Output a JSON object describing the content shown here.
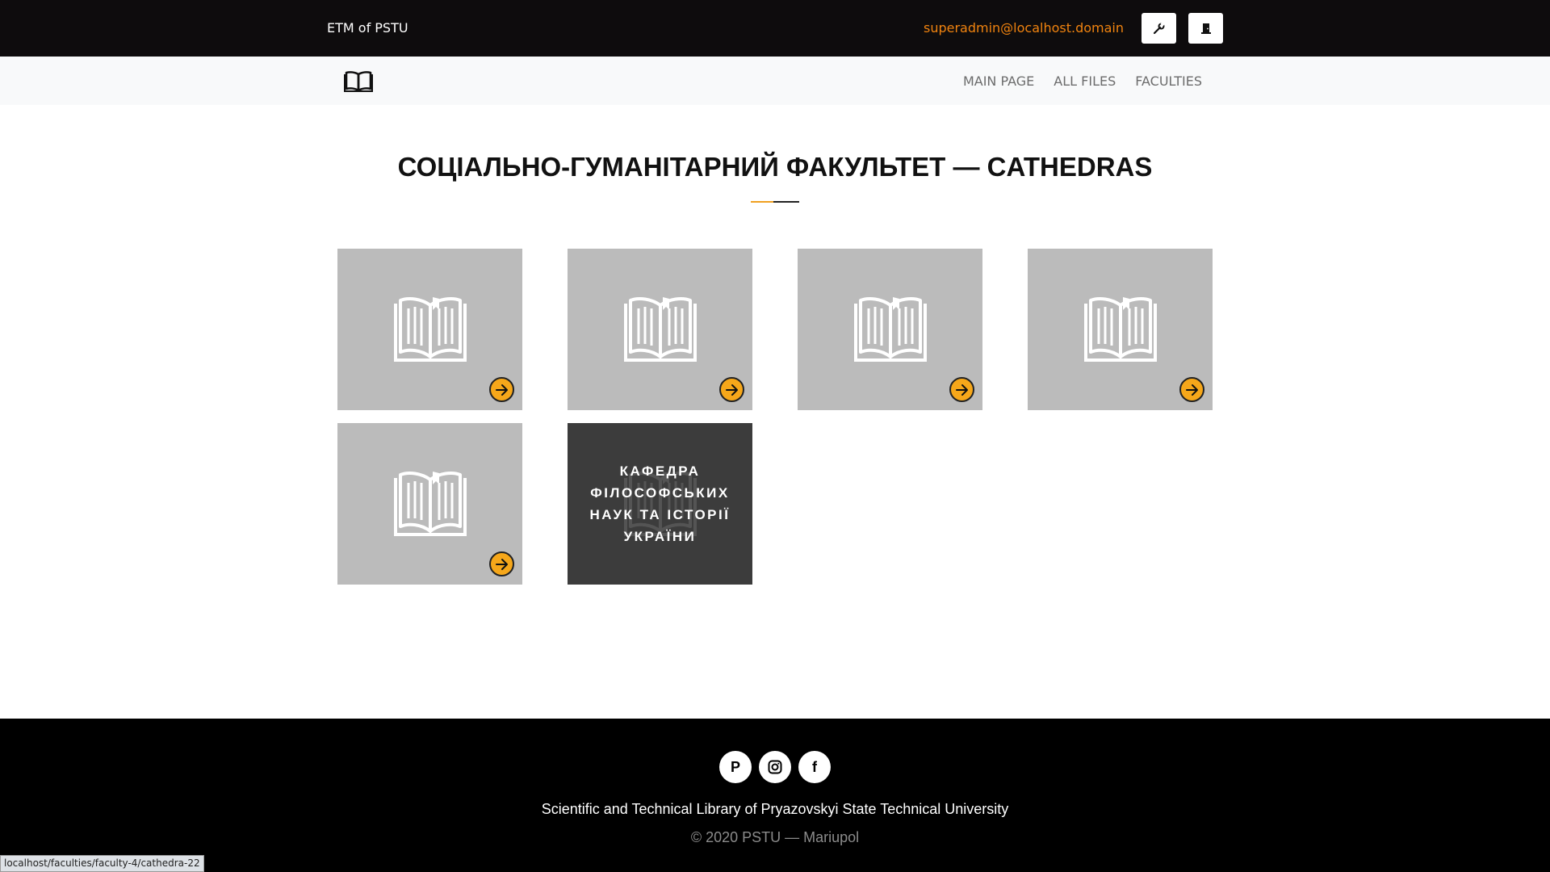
{
  "header": {
    "brand": "ETM of PSTU",
    "user_email": "superadmin@localhost.domain",
    "tools_icon": "wrench-icon",
    "logout_icon": "door-icon"
  },
  "nav": {
    "logo_icon": "book-icon",
    "links": [
      "MAIN PAGE",
      "ALL FILES",
      "FACULTIES"
    ]
  },
  "main": {
    "title": "СОЦІАЛЬНО-ГУМАНІТАРНИЙ ФАКУЛЬТЕТ — CATHEDRAS",
    "cards": [
      {
        "label": ""
      },
      {
        "label": ""
      },
      {
        "label": ""
      },
      {
        "label": ""
      },
      {
        "label": ""
      },
      {
        "label": "КАФЕДРА ФІЛОСОФСЬКИХ НАУК ТА ІСТОРІЇ УКРАЇНИ"
      }
    ]
  },
  "footer": {
    "socials": [
      "P",
      "instagram-icon",
      "f"
    ],
    "line1": "Scientific and Technical Library of Pryazovskyi State Technical University",
    "line2": "© 2020 PSTU — Mariupol"
  },
  "status_url": "localhost/faculties/faculty-4/cathedra-22",
  "colors": {
    "accent": "#f0830f",
    "arrow": "#f6a71a",
    "card": "#bbbbbb",
    "card_hover": "#3c3c3c"
  }
}
